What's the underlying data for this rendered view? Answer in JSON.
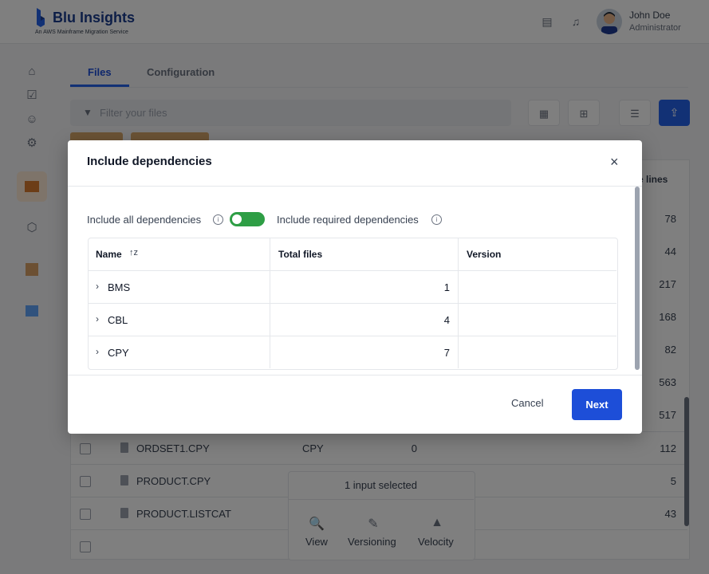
{
  "header": {
    "app_name": "Blu Insights",
    "app_subtitle": "An AWS Mainframe Migration Service",
    "user_name": "John Doe",
    "user_role": "Administrator"
  },
  "tabs": [
    {
      "label": "Files",
      "active": true
    },
    {
      "label": "Configuration",
      "active": false
    }
  ],
  "filter": {
    "placeholder": "Filter your files"
  },
  "table": {
    "partial_header": "e lines",
    "rows_behind_modal_counts": [
      "78",
      "44",
      "217",
      "168",
      "82",
      "563",
      "517"
    ],
    "rows": [
      {
        "name": "ORDSET1.CPY",
        "type": "CPY",
        "count": "0",
        "lines": "112"
      },
      {
        "name": "PRODUCT.CPY",
        "type": "",
        "count": "",
        "lines": "5"
      },
      {
        "name": "PRODUCT.LISTCAT",
        "type": "",
        "count": "",
        "lines": "43"
      }
    ]
  },
  "selection_panel": {
    "title": "1 input selected",
    "actions": [
      "View",
      "Versioning",
      "Velocity"
    ]
  },
  "modal": {
    "title": "Include dependencies",
    "option_all": "Include all dependencies",
    "option_required": "Include required dependencies",
    "toggle_on": true,
    "columns": [
      "Name",
      "Total files",
      "Version"
    ],
    "rows": [
      {
        "name": "BMS",
        "total": "1",
        "version": ""
      },
      {
        "name": "CBL",
        "total": "4",
        "version": ""
      },
      {
        "name": "CPY",
        "total": "7",
        "version": ""
      }
    ],
    "cancel_label": "Cancel",
    "next_label": "Next"
  },
  "colors": {
    "primary": "#1d4ed8",
    "toggle": "#2e9e45",
    "brand": "#1a3c8e"
  }
}
